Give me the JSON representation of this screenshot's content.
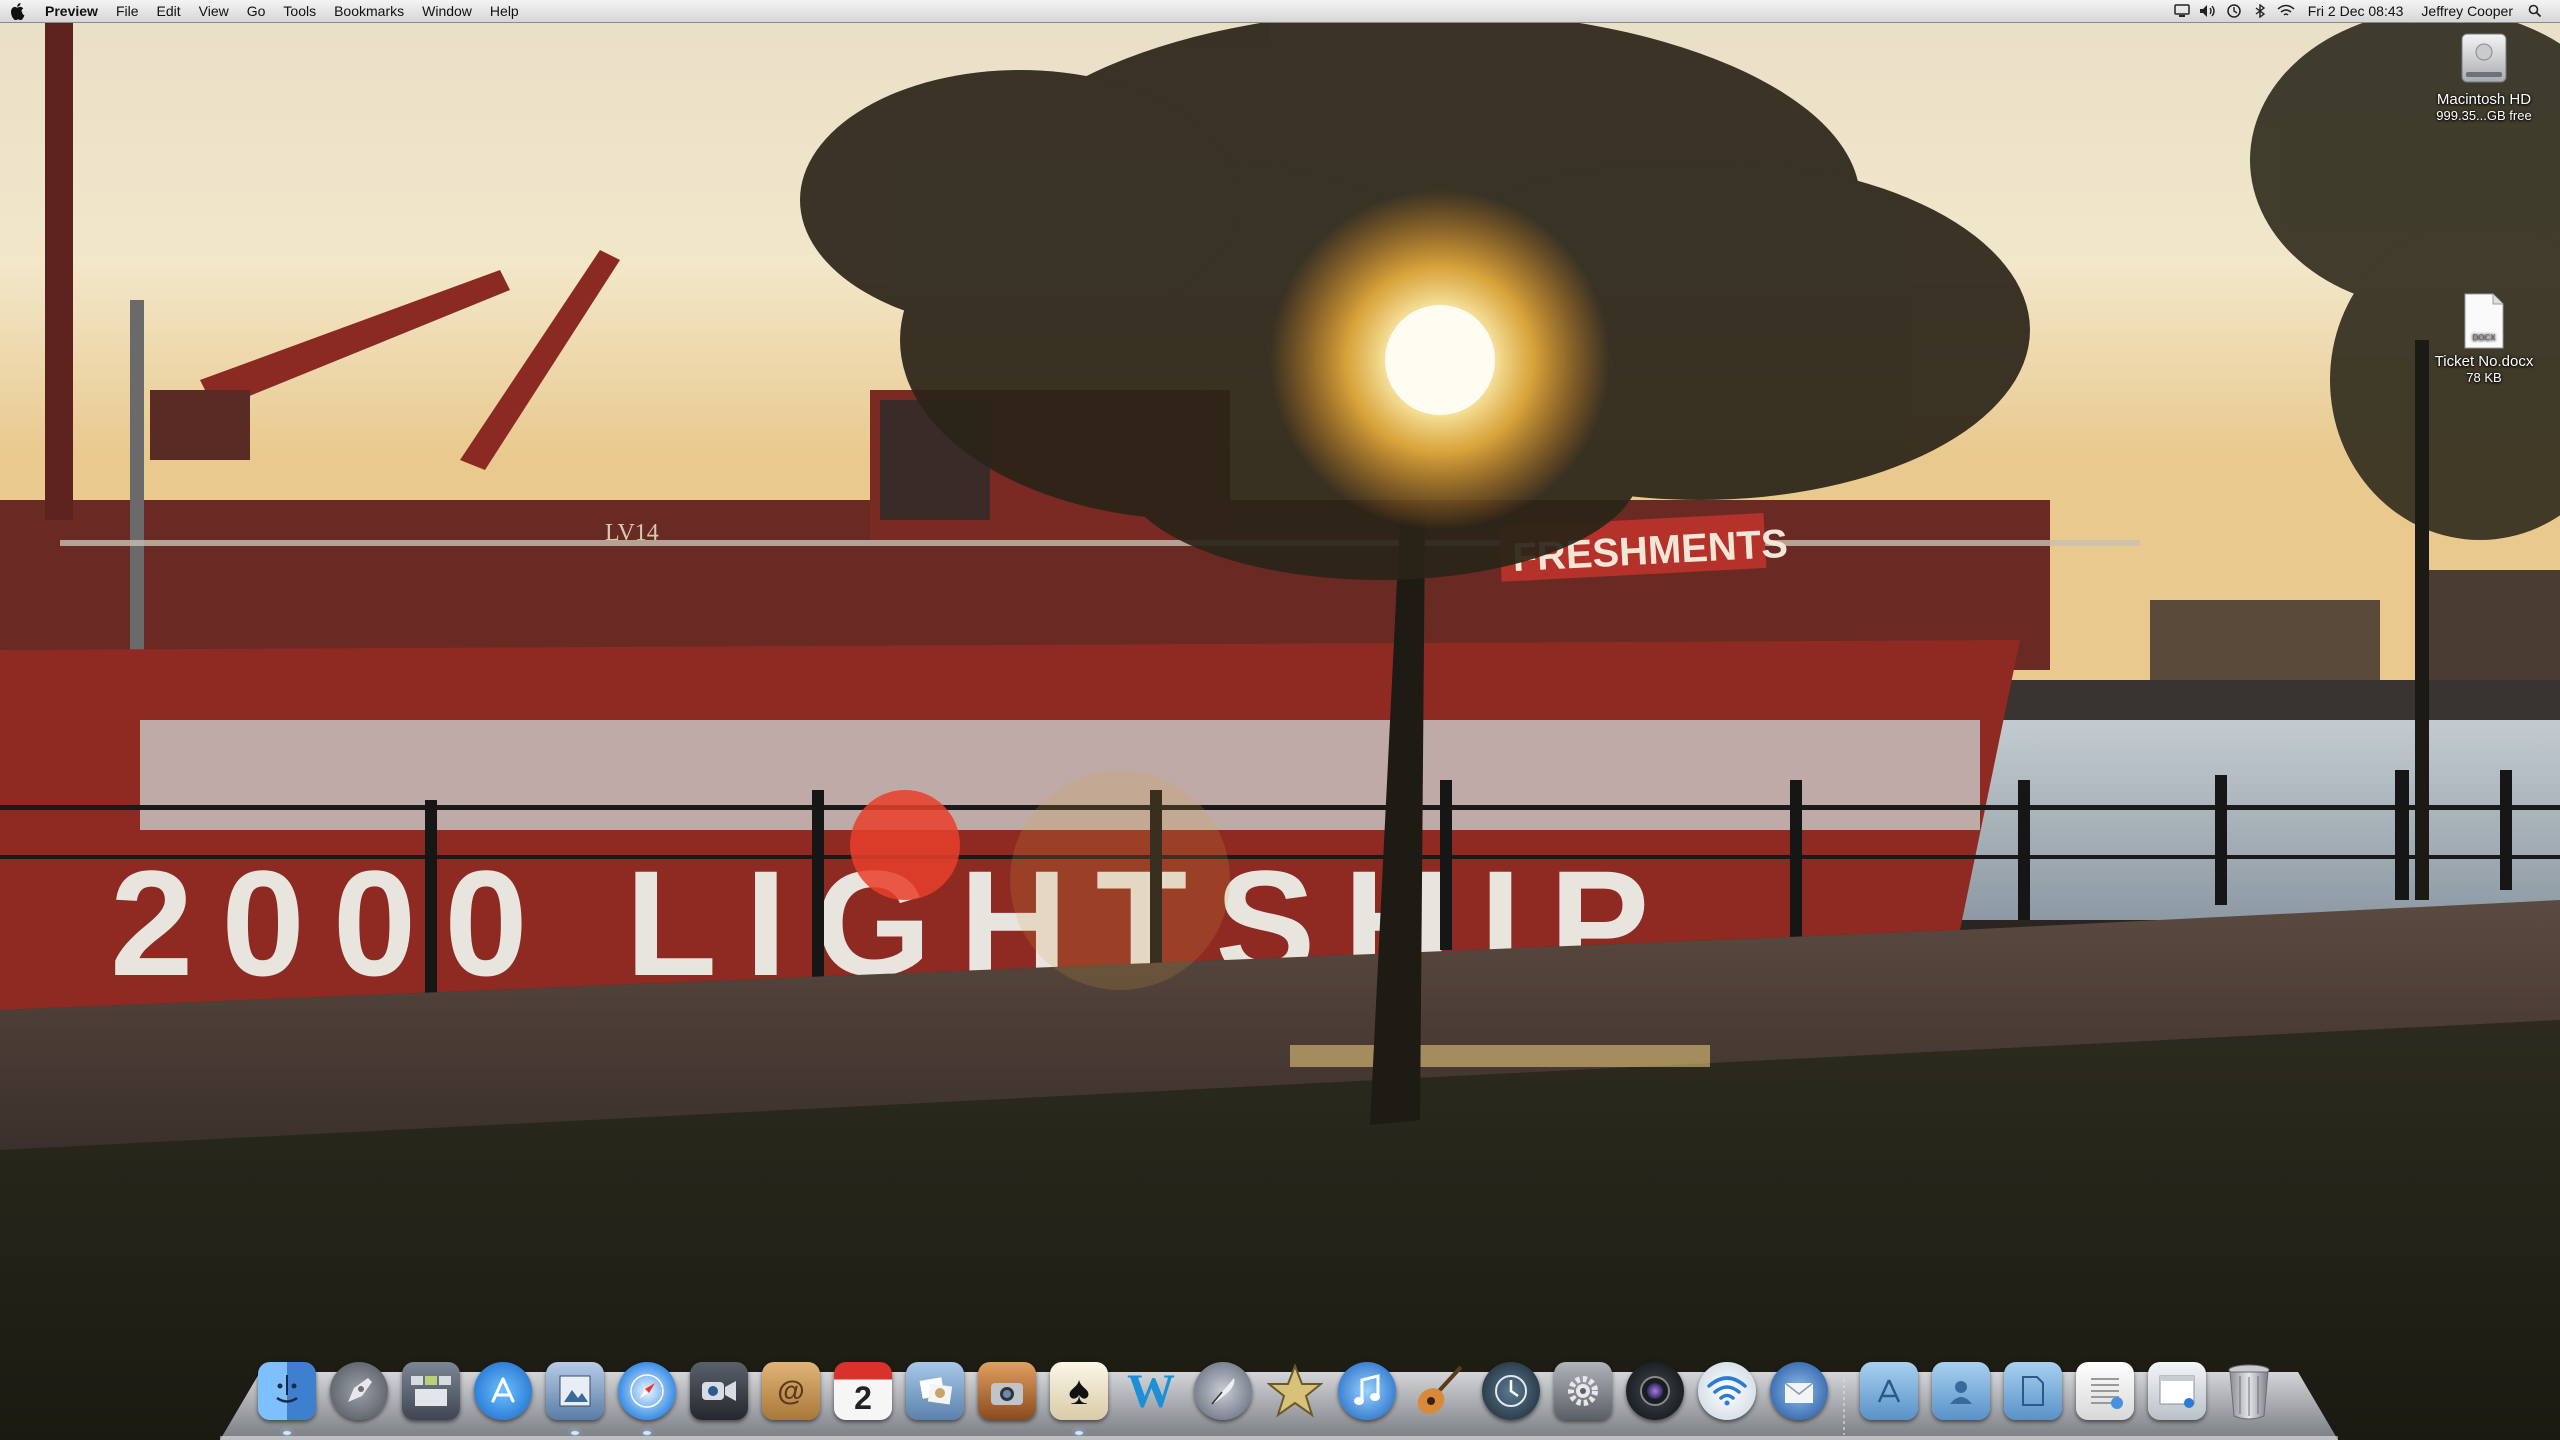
{
  "menubar": {
    "apple_icon": "apple-icon",
    "app_name": "Preview",
    "menus": [
      "File",
      "Edit",
      "View",
      "Go",
      "Tools",
      "Bookmarks",
      "Window",
      "Help"
    ],
    "status_icons": [
      "display-icon",
      "volume-icon",
      "time-machine-icon",
      "bluetooth-icon",
      "wifi-icon"
    ],
    "clock": "Fri 2 Dec  08:43",
    "user": "Jeffrey Cooper",
    "spotlight_icon": "spotlight-icon"
  },
  "desktop": {
    "hard_drive": {
      "name": "Macintosh HD",
      "info": "999.35...GB free",
      "icon": "hard-drive-icon"
    },
    "document": {
      "name": "Ticket No.docx",
      "info": "78 KB",
      "badge": "DOCX",
      "icon": "docx-file-icon"
    }
  },
  "wallpaper": {
    "ship_hull_text": "2000 LIGHTSHIP",
    "banner_text": "FRESHMENTS",
    "hull_number": "LV14"
  },
  "dock": {
    "apps": [
      {
        "name": "Finder",
        "icon": "finder-icon",
        "color": "#4a90e2",
        "running": true
      },
      {
        "name": "Launchpad",
        "icon": "launchpad-icon",
        "color": "#6b6f78",
        "running": false
      },
      {
        "name": "Mission Control",
        "icon": "mission-control-icon",
        "color": "#556070",
        "running": false
      },
      {
        "name": "App Store",
        "icon": "app-store-icon",
        "color": "#1f7fe0",
        "running": false
      },
      {
        "name": "Preview",
        "icon": "preview-icon",
        "color": "#7a9cc8",
        "running": true
      },
      {
        "name": "Safari",
        "icon": "safari-icon",
        "color": "#3a8ee6",
        "running": true
      },
      {
        "name": "FaceTime",
        "icon": "facetime-icon",
        "color": "#3b3f46",
        "running": false
      },
      {
        "name": "Address Book",
        "icon": "address-book-icon",
        "color": "#c99a5a",
        "running": false
      },
      {
        "name": "iCal",
        "icon": "calendar-icon",
        "color": "#f4f4f4",
        "running": false,
        "label": "2"
      },
      {
        "name": "iPhoto",
        "icon": "iphoto-icon",
        "color": "#8ab2d8",
        "running": false
      },
      {
        "name": "Image Capture",
        "icon": "image-capture-icon",
        "color": "#c57a3a",
        "running": false
      },
      {
        "name": "Solitaire",
        "icon": "spade-card-icon",
        "color": "#f0e6c8",
        "running": true
      },
      {
        "name": "Word",
        "icon": "word-w-icon",
        "color": "#1c8fd6",
        "running": false
      },
      {
        "name": "Script Editor",
        "icon": "quill-icon",
        "color": "#8e96a6",
        "running": false
      },
      {
        "name": "iMovie",
        "icon": "star-icon",
        "color": "#b8a46a",
        "running": false
      },
      {
        "name": "iTunes",
        "icon": "itunes-icon",
        "color": "#2a7fd8",
        "running": false
      },
      {
        "name": "GarageBand",
        "icon": "guitar-icon",
        "color": "#c2763a",
        "running": false
      },
      {
        "name": "Time Machine",
        "icon": "time-machine-icon",
        "color": "#2e3c48",
        "running": false
      },
      {
        "name": "System Preferences",
        "icon": "gear-icon",
        "color": "#8a8d92",
        "running": false
      },
      {
        "name": "Photo Booth",
        "icon": "camera-lens-icon",
        "color": "#222428",
        "running": false
      },
      {
        "name": "AirPort Utility",
        "icon": "wifi-icon",
        "color": "#e8eef4",
        "running": false
      },
      {
        "name": "Thunderbird",
        "icon": "thunderbird-icon",
        "color": "#2f6fb8",
        "running": false
      }
    ],
    "stacks": [
      {
        "name": "Applications",
        "icon": "applications-folder-icon",
        "color": "#6ea6d8"
      },
      {
        "name": "Home",
        "icon": "home-folder-icon",
        "color": "#6ea6d8"
      },
      {
        "name": "Documents",
        "icon": "documents-folder-icon",
        "color": "#6ea6d8"
      },
      {
        "name": "Downloads",
        "icon": "downloads-document-icon",
        "color": "#eeeeee"
      },
      {
        "name": "Window",
        "icon": "minimized-window-icon",
        "color": "#dfe6ee"
      },
      {
        "name": "Trash",
        "icon": "trash-icon",
        "color": "#b8bcc2"
      }
    ]
  }
}
